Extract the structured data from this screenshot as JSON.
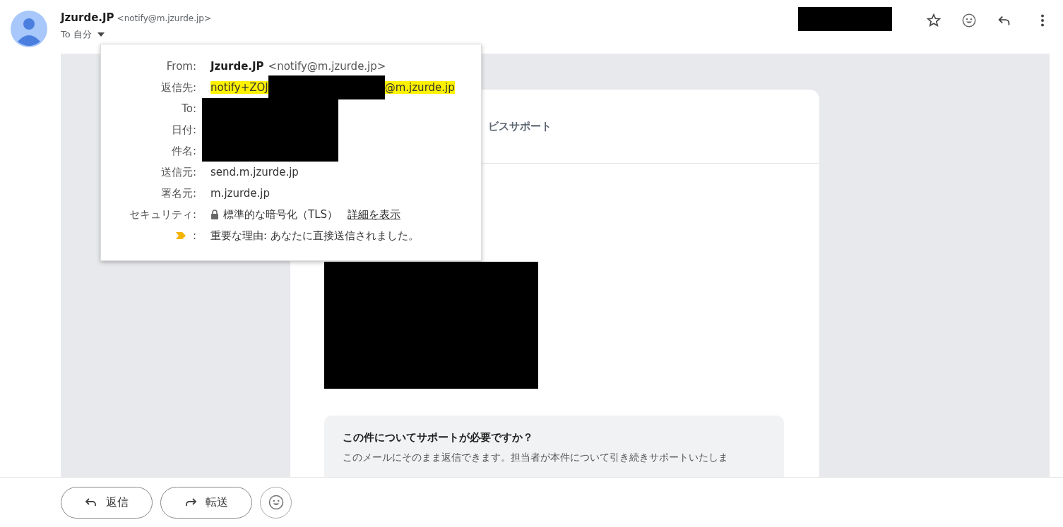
{
  "sender": {
    "name": "Jzurde.JP",
    "email": "<notify@m.jzurde.jp>",
    "recipient": "To 自分"
  },
  "details_popup": {
    "rows": [
      {
        "label": "From:",
        "kind": "sender",
        "name": "Jzurde.JP",
        "email": "<notify@m.jzurde.jp>"
      },
      {
        "label": "返信先:",
        "kind": "highlighted",
        "prefix": "notify+ZOJ",
        "suffix": "@m.jzurde.jp"
      },
      {
        "label": "To:",
        "kind": "redacted"
      },
      {
        "label": "日付:",
        "kind": "redacted"
      },
      {
        "label": "件名:",
        "kind": "redacted"
      },
      {
        "label": "送信元:",
        "kind": "text",
        "value": "send.m.jzurde.jp"
      },
      {
        "label": "署名元:",
        "kind": "text",
        "value": "m.jzurde.jp"
      },
      {
        "label": "セキュリティ:",
        "kind": "security",
        "value": "標準的な暗号化（TLS）",
        "link": "詳細を表示"
      },
      {
        "label": ":",
        "kind": "importance",
        "value": "重要な理由: あなたに直接送信されました。"
      }
    ]
  },
  "email_body": {
    "banner_text": "ビスサポート",
    "support_box": {
      "title": "この件についてサポートが必要ですか？",
      "text": "このメールにそのまま返信できます。担当者が本件について引き続きサポートいたしま"
    }
  },
  "bottom_buttons": [
    {
      "kind": "reply",
      "label": "返信"
    },
    {
      "kind": "forward",
      "label": "転送"
    }
  ]
}
